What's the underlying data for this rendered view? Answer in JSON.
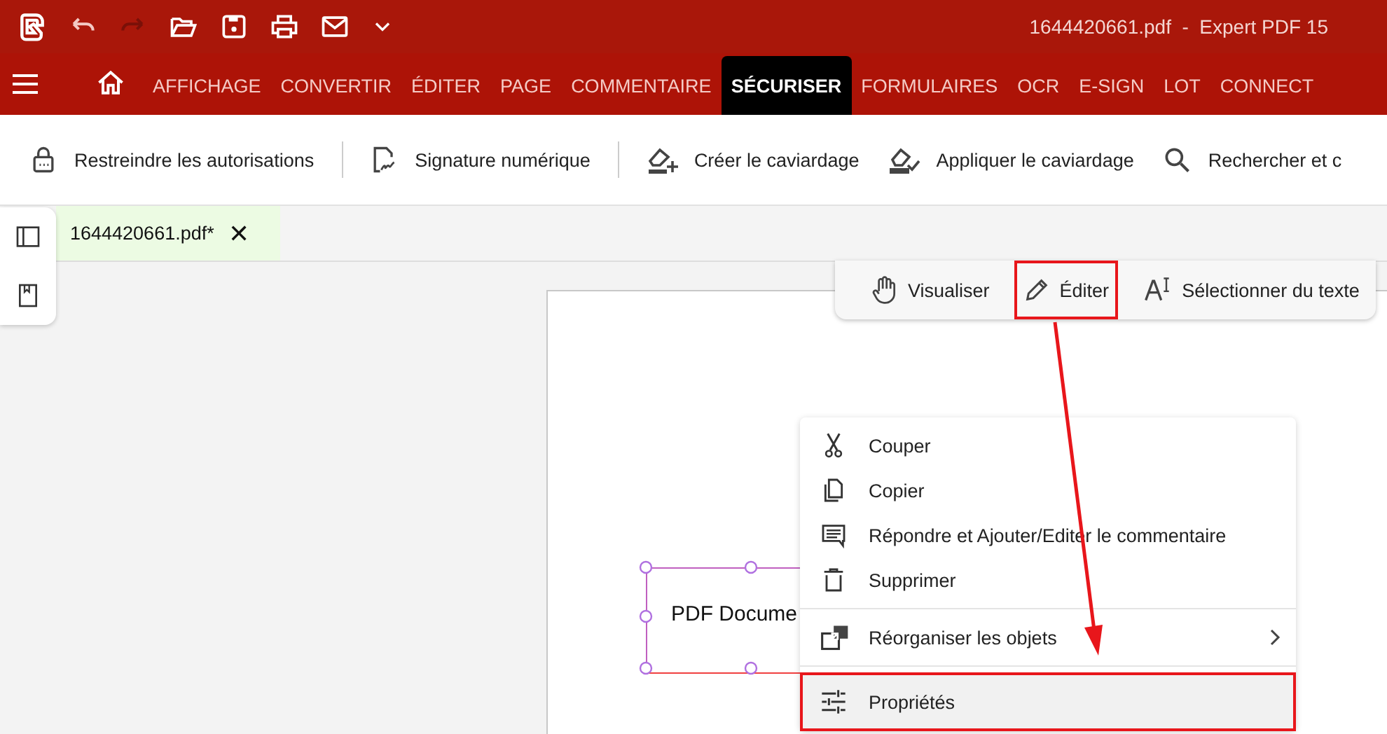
{
  "window": {
    "title": "1644420661.pdf  -  Expert PDF 15"
  },
  "ribbon_tabs": [
    {
      "label": "AFFICHAGE",
      "selected": false
    },
    {
      "label": "CONVERTIR",
      "selected": false
    },
    {
      "label": "ÉDITER",
      "selected": false
    },
    {
      "label": "PAGE",
      "selected": false
    },
    {
      "label": "COMMENTAIRE",
      "selected": false
    },
    {
      "label": "SÉCURISER",
      "selected": true
    },
    {
      "label": "FORMULAIRES",
      "selected": false
    },
    {
      "label": "OCR",
      "selected": false
    },
    {
      "label": "E-SIGN",
      "selected": false
    },
    {
      "label": "LOT",
      "selected": false
    },
    {
      "label": "CONNECT",
      "selected": false
    }
  ],
  "toolbar": [
    {
      "label": "Restreindre les autorisations",
      "kind": "lock"
    },
    {
      "label": "Signature numérique",
      "kind": "signature"
    },
    {
      "label": "Créer le caviardage",
      "kind": "redact-create"
    },
    {
      "label": "Appliquer le caviardage",
      "kind": "redact-apply"
    },
    {
      "label": "Rechercher et c",
      "kind": "search"
    }
  ],
  "document_tab": {
    "label": "1644420661.pdf*",
    "close": "✕"
  },
  "mode_tools": [
    {
      "label": "Visualiser",
      "kind": "hand",
      "outlined": false
    },
    {
      "label": "Éditer",
      "kind": "pencil",
      "outlined": true
    },
    {
      "label": "Sélectionner du texte",
      "kind": "text",
      "outlined": false
    }
  ],
  "text_box": {
    "text": "PDF Docume"
  },
  "context_menu": [
    {
      "label": "Couper",
      "kind": "cut",
      "divider_above": false,
      "submenu": false,
      "selected": false,
      "outlined": false
    },
    {
      "label": "Copier",
      "kind": "copy",
      "divider_above": false,
      "submenu": false,
      "selected": false,
      "outlined": false
    },
    {
      "label": "Répondre et Ajouter/Editer le commentaire",
      "kind": "comment",
      "divider_above": false,
      "submenu": false,
      "selected": false,
      "outlined": false
    },
    {
      "label": "Supprimer",
      "kind": "delete",
      "divider_above": false,
      "submenu": false,
      "selected": false,
      "outlined": false
    },
    {
      "label": "Réorganiser les objets",
      "kind": "arrange",
      "divider_above": true,
      "submenu": true,
      "selected": false,
      "outlined": false
    },
    {
      "label": "Propriétés",
      "kind": "properties",
      "divider_above": true,
      "submenu": false,
      "selected": true,
      "outlined": true
    }
  ]
}
